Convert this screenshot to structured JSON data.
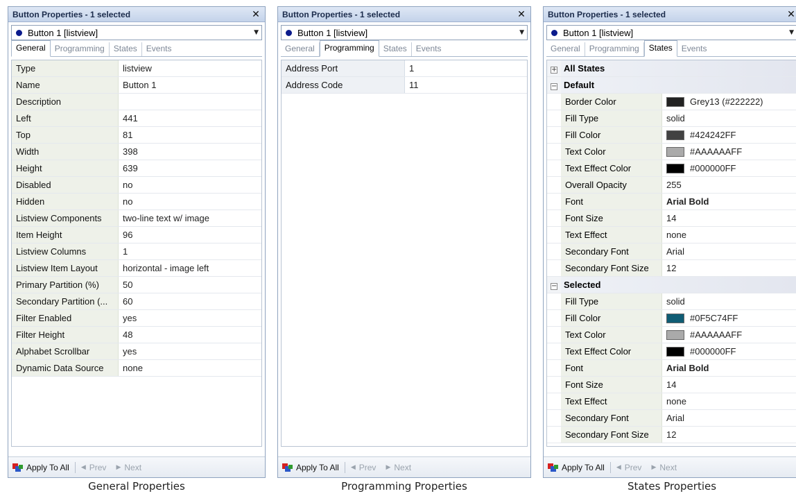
{
  "panels": {
    "general": {
      "title": "Button Properties - 1 selected",
      "selector": "Button 1  [listview]",
      "tabs": [
        "General",
        "Programming",
        "States",
        "Events"
      ],
      "rows": [
        {
          "k": "Type",
          "v": "listview"
        },
        {
          "k": "Name",
          "v": "Button 1"
        },
        {
          "k": "Description",
          "v": ""
        },
        {
          "k": "Left",
          "v": "441"
        },
        {
          "k": "Top",
          "v": "81"
        },
        {
          "k": "Width",
          "v": "398"
        },
        {
          "k": "Height",
          "v": "639"
        },
        {
          "k": "Disabled",
          "v": "no"
        },
        {
          "k": "Hidden",
          "v": "no"
        },
        {
          "k": "Listview Components",
          "v": "two-line text w/ image"
        },
        {
          "k": "Item Height",
          "v": "96"
        },
        {
          "k": "Listview Columns",
          "v": "1"
        },
        {
          "k": "Listview Item Layout",
          "v": "horizontal - image left"
        },
        {
          "k": "Primary Partition (%)",
          "v": "50"
        },
        {
          "k": "Secondary Partition (...",
          "v": "60"
        },
        {
          "k": "Filter Enabled",
          "v": "yes"
        },
        {
          "k": "Filter Height",
          "v": "48"
        },
        {
          "k": "Alphabet Scrollbar",
          "v": "yes"
        },
        {
          "k": "Dynamic Data Source",
          "v": "none"
        }
      ]
    },
    "programming": {
      "title": "Button Properties - 1 selected",
      "selector": "Button 1  [listview]",
      "tabs": [
        "General",
        "Programming",
        "States",
        "Events"
      ],
      "rows": [
        {
          "k": "Address Port",
          "v": "1"
        },
        {
          "k": "Address Code",
          "v": "11"
        }
      ]
    },
    "states": {
      "title": "Button Properties - 1 selected",
      "selector": "Button 1  [listview]",
      "tabs": [
        "General",
        "Programming",
        "States",
        "Events"
      ],
      "group_all": "All States",
      "group_default": "Default",
      "group_selected": "Selected",
      "default_rows": [
        {
          "k": "Border Color",
          "v": "Grey13 (#222222)",
          "color": "#222222"
        },
        {
          "k": "Fill Type",
          "v": "solid"
        },
        {
          "k": "Fill Color",
          "v": "#424242FF",
          "color": "#424242"
        },
        {
          "k": "Text Color",
          "v": "#AAAAAAFF",
          "color": "#AAAAAA"
        },
        {
          "k": "Text Effect Color",
          "v": "#000000FF",
          "color": "#000000"
        },
        {
          "k": "Overall Opacity",
          "v": "255"
        },
        {
          "k": "Font",
          "v": "Arial Bold",
          "bold": true
        },
        {
          "k": "Font Size",
          "v": "14"
        },
        {
          "k": "Text Effect",
          "v": "none"
        },
        {
          "k": "Secondary Font",
          "v": "Arial"
        },
        {
          "k": "Secondary Font Size",
          "v": "12"
        }
      ],
      "selected_rows": [
        {
          "k": "Fill Type",
          "v": "solid"
        },
        {
          "k": "Fill Color",
          "v": "#0F5C74FF",
          "color": "#0F5C74"
        },
        {
          "k": "Text Color",
          "v": "#AAAAAAFF",
          "color": "#AAAAAA"
        },
        {
          "k": "Text Effect Color",
          "v": "#000000FF",
          "color": "#000000"
        },
        {
          "k": "Font",
          "v": "Arial Bold",
          "bold": true
        },
        {
          "k": "Font Size",
          "v": "14"
        },
        {
          "k": "Text Effect",
          "v": "none"
        },
        {
          "k": "Secondary Font",
          "v": "Arial"
        },
        {
          "k": "Secondary Font Size",
          "v": "12"
        }
      ]
    }
  },
  "footer": {
    "apply_label": "Apply To All",
    "prev_label": "Prev",
    "next_label": "Next"
  },
  "captions": {
    "general": "General Properties",
    "programming": "Programming Properties",
    "states": "States Properties"
  },
  "icons": {
    "close": "close-icon",
    "dropdown": "chevron-down-icon",
    "apply": "apply-to-all-icon",
    "prev": "prev-arrow-icon",
    "next": "next-arrow-icon",
    "expand": "plus-box-icon",
    "collapse": "minus-box-icon"
  },
  "colors": {
    "title_bg": "#c3d3ea",
    "key_bg": "#eef1e9",
    "object_dot": "#0b1b8c"
  }
}
